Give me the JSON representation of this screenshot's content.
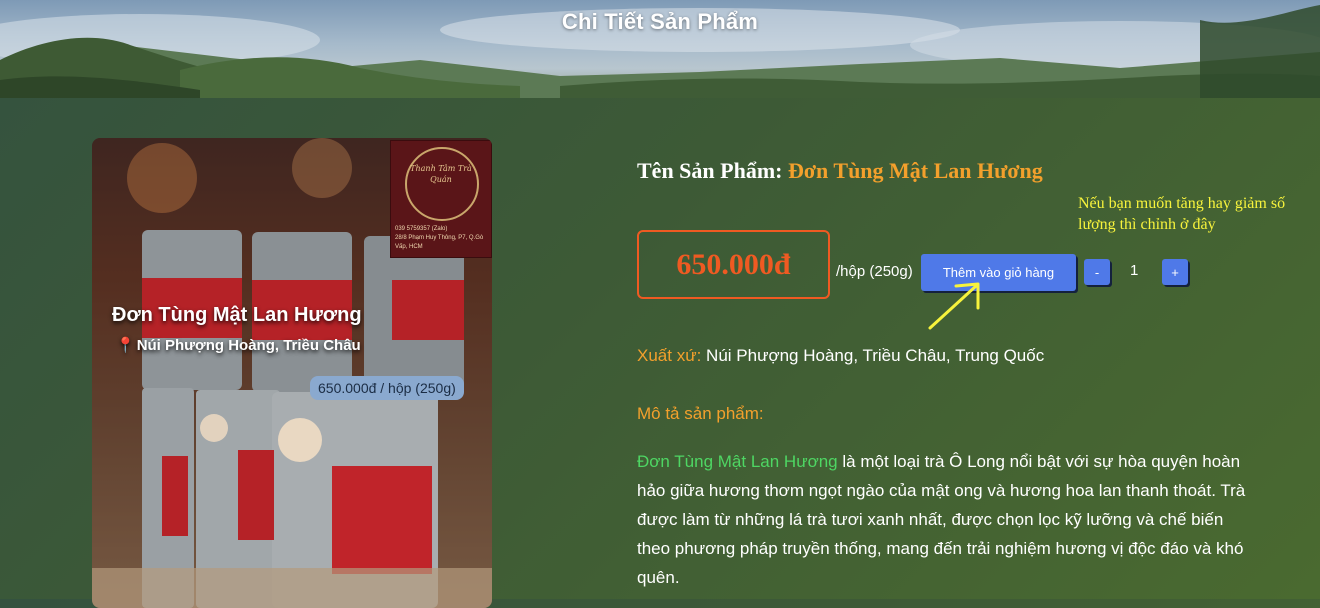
{
  "banner": {
    "title": "Chi Tiết Sản Phẩm"
  },
  "image": {
    "logo_brand": "Thanh Tâm Trà Quán",
    "logo_phone": "039 5759357 (Zalo)",
    "logo_address": "28/8 Phạm Huy Thông, P7, Q.Gò Vấp, HCM",
    "overlay_name": "Đơn Tùng Mật Lan Hương",
    "overlay_origin": "Núi Phượng Hoàng, Triều Châu",
    "overlay_price": "650.000đ / hộp (250g)"
  },
  "product": {
    "title_label": "Tên Sản Phẩm:",
    "title_value": "Đơn Tùng Mật Lan Hương",
    "price": "650.000đ",
    "unit": "/hộp (250g)",
    "add_to_cart": "Thêm vào giỏ hàng",
    "qty_minus": "-",
    "qty_value": "1",
    "qty_plus": "+",
    "hint": "Nếu bạn muốn tăng hay giảm số lượng thì chỉnh ở đây",
    "origin_label": "Xuất xứ:",
    "origin_value": "Núi Phượng Hoàng, Triều Châu, Trung Quốc",
    "description_label": "Mô tả sản phẩm:",
    "description_highlight": "Đơn Tùng Mật Lan Hương",
    "description_text": "là một loại trà Ô Long nổi bật với sự hòa quyện hoàn hảo giữa hương thơm ngọt ngào của mật ong và hương hoa lan thanh thoát. Trà được làm từ những lá trà tươi xanh nhất, được chọn lọc kỹ lưỡng và chế biến theo phương pháp truyền thống, mang đến trải nghiệm hương vị độc đáo và khó quên."
  },
  "colors": {
    "accent_orange": "#f3a02c",
    "price_red": "#ef5a22",
    "button_blue": "#4f79e8",
    "highlight_green": "#4ed663",
    "hint_yellow": "#f7f33c"
  }
}
